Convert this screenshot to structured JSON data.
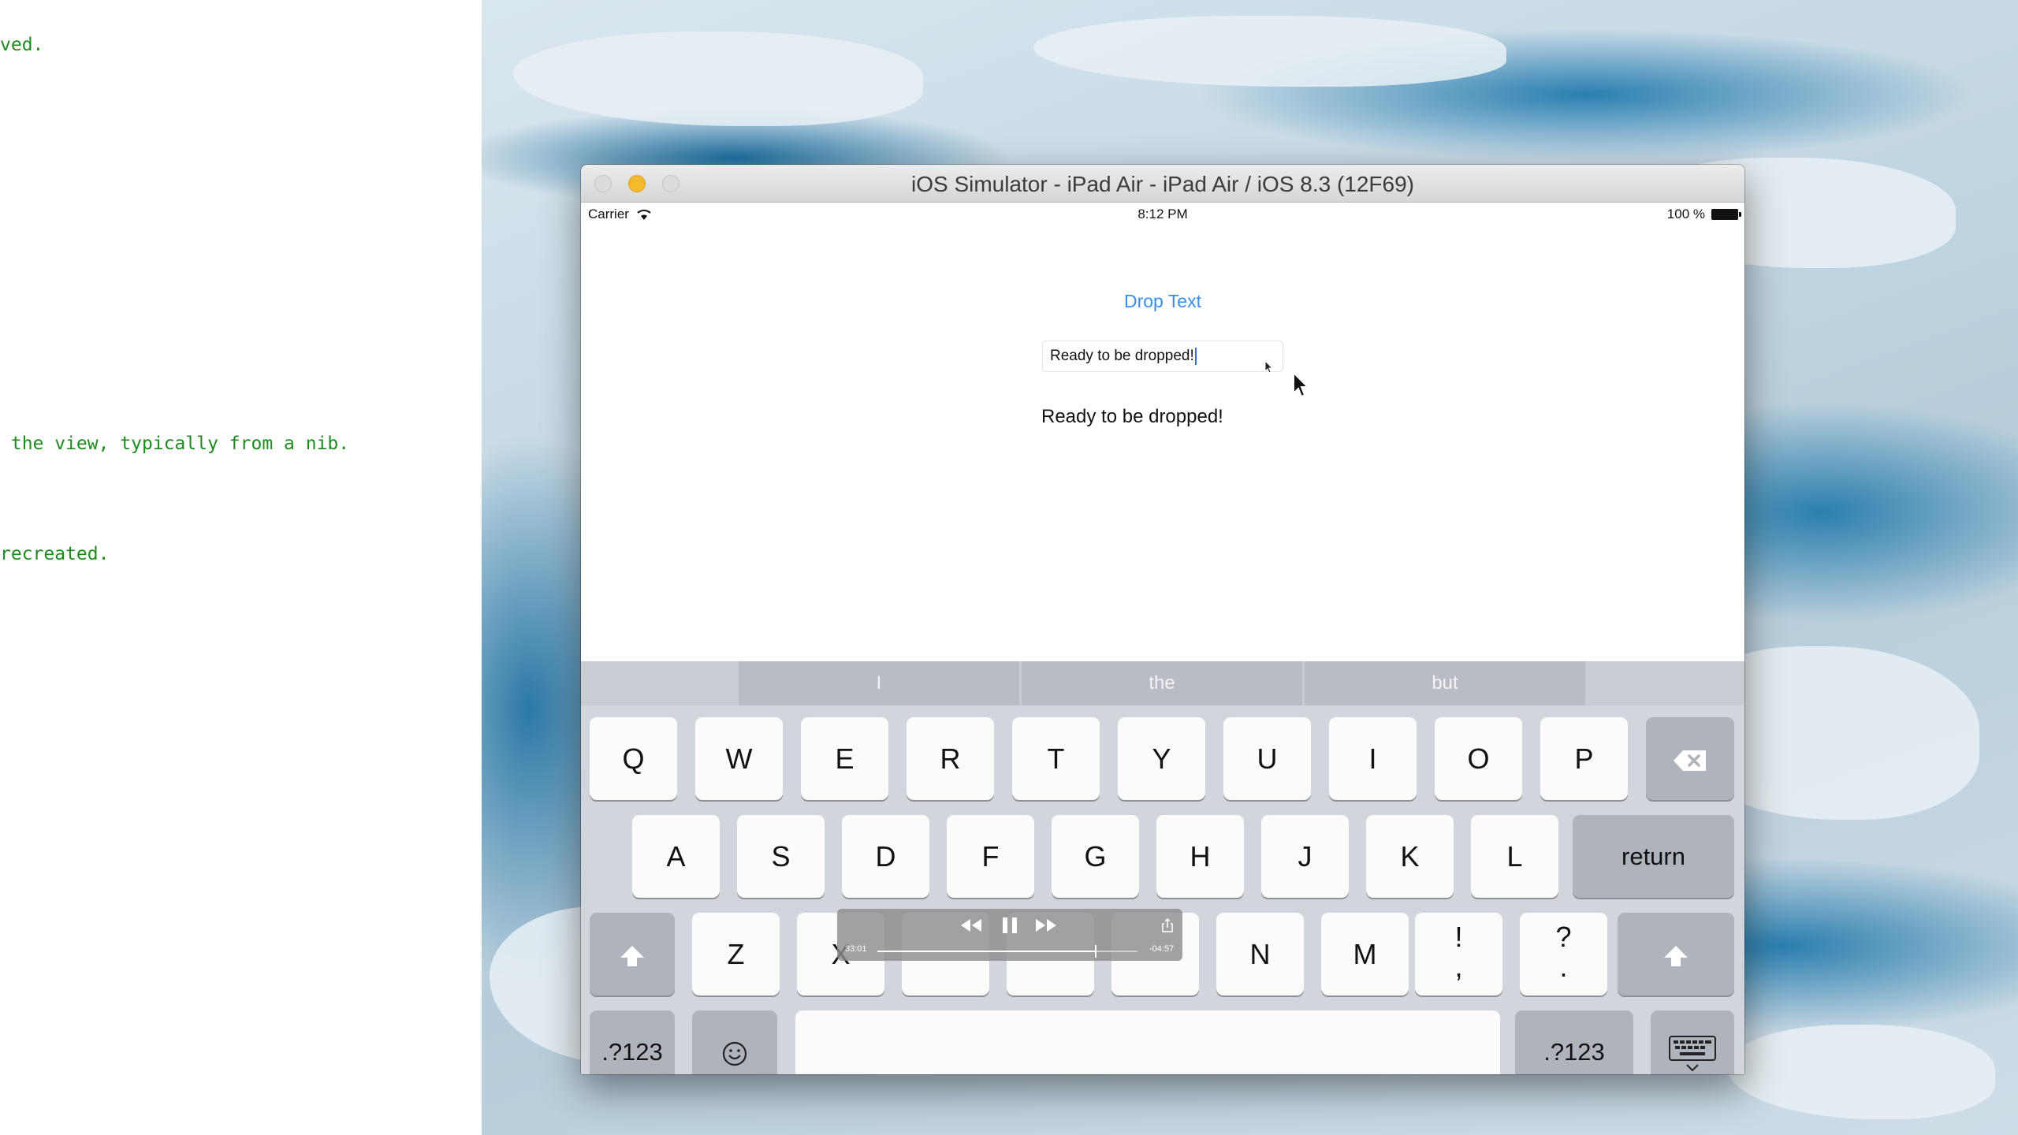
{
  "editor": {
    "lines": [
      "ved.",
      " the view, typically from a nib.",
      "recreated."
    ]
  },
  "window": {
    "title": "iOS Simulator - iPad Air - iPad Air / iOS 8.3 (12F69)"
  },
  "status_bar": {
    "carrier": "Carrier",
    "time": "8:12 PM",
    "battery": "100 %"
  },
  "app": {
    "drop_button": "Drop Text",
    "text_field_value": "Ready to be dropped!",
    "result_label": "Ready to be dropped!"
  },
  "keyboard": {
    "predictions": [
      "I",
      "the",
      "but"
    ],
    "row1": [
      "Q",
      "W",
      "E",
      "R",
      "T",
      "Y",
      "U",
      "I",
      "O",
      "P"
    ],
    "row2": [
      "A",
      "S",
      "D",
      "F",
      "G",
      "H",
      "J",
      "K",
      "L"
    ],
    "return_label": "return",
    "row3_left": [
      "Z",
      "X"
    ],
    "row3_right": [
      "N",
      "M"
    ],
    "exclaim_top": "!",
    "exclaim_bottom": ",",
    "question_top": "?",
    "question_bottom": ".",
    "numbers_label": ".?123"
  },
  "player": {
    "elapsed": "33:01",
    "remaining": "-04:57",
    "progress": 0.84
  },
  "colors": {
    "accent": "#3a8ee6",
    "code_comment": "#1f8a1f",
    "minimize": "#f5b92d"
  }
}
